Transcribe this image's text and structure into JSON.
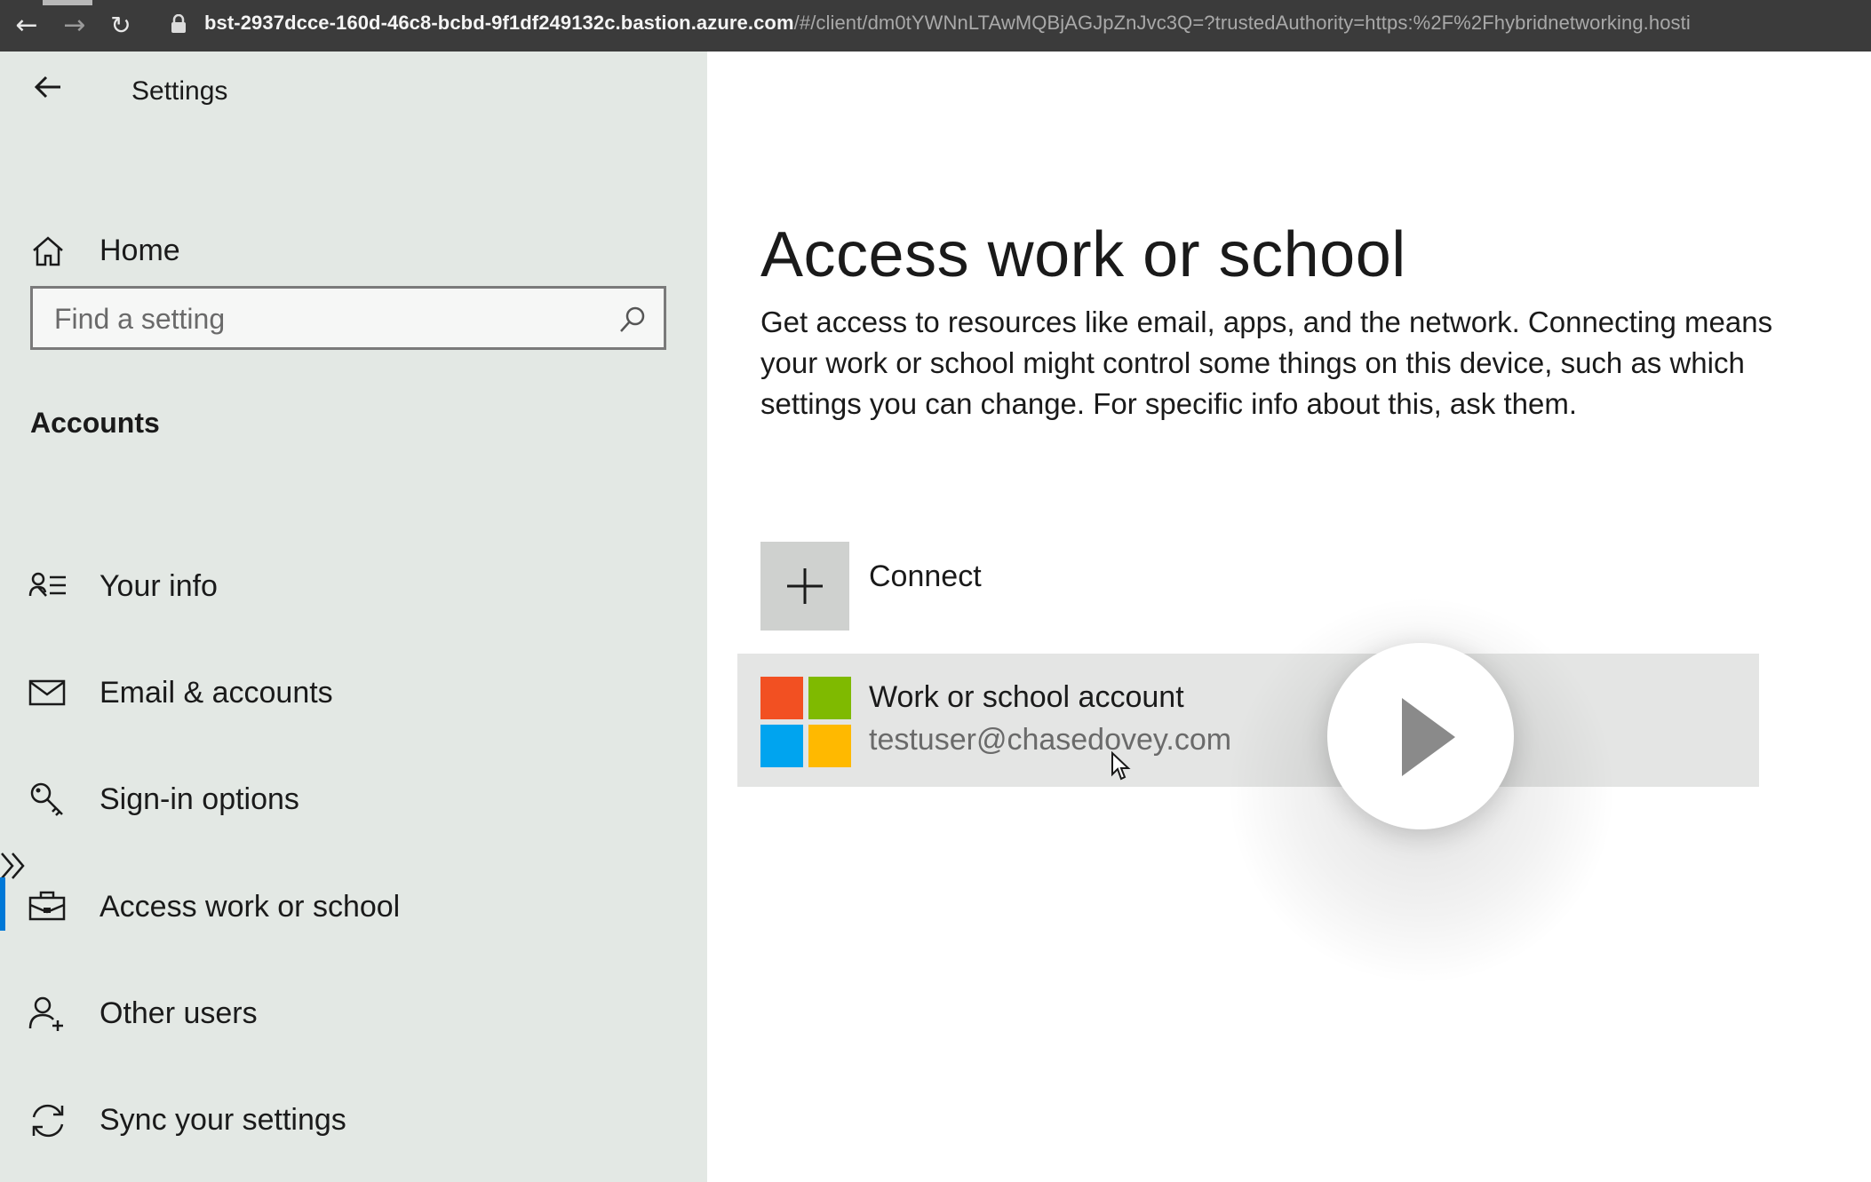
{
  "browser": {
    "url_host": "bst-2937dcce-160d-46c8-bcbd-9f1df249132c.bastion.azure.com",
    "url_path": "/#/client/dm0tYWNnLTAwMQBjAGJpZnJvc3Q=?trustedAuthority=https:%2F%2Fhybridnetworking.hosti"
  },
  "sidebar": {
    "title": "Settings",
    "home_label": "Home",
    "search_placeholder": "Find a setting",
    "section_label": "Accounts",
    "items": [
      {
        "label": "Your info",
        "icon": "person-list-icon"
      },
      {
        "label": "Email & accounts",
        "icon": "mail-icon"
      },
      {
        "label": "Sign-in options",
        "icon": "key-icon"
      },
      {
        "label": "Access work or school",
        "icon": "briefcase-icon",
        "selected": true
      },
      {
        "label": "Other users",
        "icon": "person-add-icon"
      },
      {
        "label": "Sync your settings",
        "icon": "sync-icon"
      }
    ]
  },
  "main": {
    "title": "Access work or school",
    "description": "Get access to resources like email, apps, and the network. Connecting means your work or school might control some things on this device, such as which settings you can change. For specific info about this, ask them.",
    "connect_label": "Connect",
    "account": {
      "name": "Work or school account",
      "email": "testuser@chasedovey.com"
    }
  },
  "colors": {
    "accent": "#0078d7",
    "sidebar_bg": "#e3e8e4",
    "ms_red": "#f25022",
    "ms_green": "#7fba00",
    "ms_blue": "#00a4ef",
    "ms_yellow": "#ffb900"
  }
}
